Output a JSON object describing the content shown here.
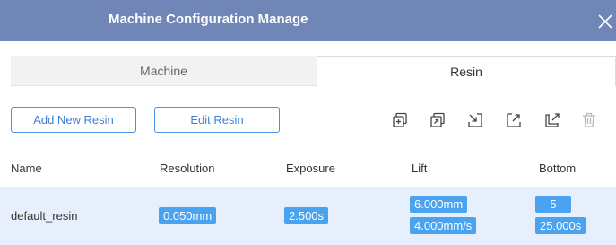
{
  "window": {
    "title": "Machine Configuration Manage"
  },
  "tabs": [
    {
      "label": "Machine",
      "active": false
    },
    {
      "label": "Resin",
      "active": true
    }
  ],
  "toolbar": {
    "add_label": "Add New Resin",
    "edit_label": "Edit Resin",
    "icons": [
      "add-copy-icon",
      "duplicate-icon",
      "import-icon",
      "export-icon",
      "export-all-icon",
      "delete-icon"
    ]
  },
  "table": {
    "columns": [
      "Name",
      "Resolution",
      "Exposure",
      "Lift",
      "Bottom"
    ],
    "rows": [
      {
        "name": "default_resin",
        "resolution": "0.050mm",
        "exposure": "2.500s",
        "lift_distance": "6.000mm",
        "lift_speed": "4.000mm/s",
        "bottom_layers": "5",
        "bottom_exposure": "25.000s"
      }
    ]
  },
  "colors": {
    "titlebar": "#6f86b6",
    "accent": "#4a90e2",
    "badge": "#4aa3f0",
    "selected_row": "#e6effb"
  }
}
